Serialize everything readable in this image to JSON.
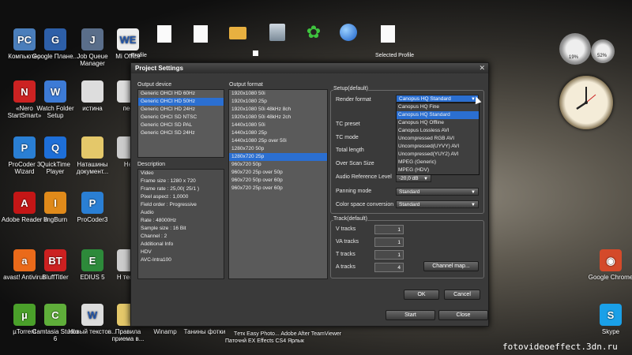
{
  "desktop": {
    "icons": [
      {
        "label": "Компьютер",
        "color": "#4a7ebb",
        "glyph": "PC"
      },
      {
        "label": "Google Плане...",
        "color": "#2d5fa8",
        "glyph": "G"
      },
      {
        "label": "Job Queue Manager",
        "color": "#5a6e8a",
        "glyph": "J"
      },
      {
        "label": "Mi Office",
        "color": "#eeeeee",
        "glyph": "WE"
      },
      {
        "label": "«Nero StartSmart»",
        "color": "#cc2222",
        "glyph": "N"
      },
      {
        "label": "Watch Folder Setup",
        "color": "#3d7bd6",
        "glyph": "W"
      },
      {
        "label": "истина",
        "color": "#dddddd",
        "glyph": ""
      },
      {
        "label": "пес",
        "color": "#dddddd",
        "glyph": ""
      },
      {
        "label": "ProCoder 3 Wizard",
        "color": "#2a7fd4",
        "glyph": "P"
      },
      {
        "label": "QuickTime Player",
        "color": "#1e6fd8",
        "glyph": "Q"
      },
      {
        "label": "Наташины документ...",
        "color": "#e4c86a",
        "glyph": ""
      },
      {
        "label": "Не",
        "color": "#cccccc",
        "glyph": ""
      },
      {
        "label": "Adobe Reader 8",
        "color": "#c41616",
        "glyph": "A"
      },
      {
        "label": "ImgBurn",
        "color": "#e08a1a",
        "glyph": "I"
      },
      {
        "label": "ProCoder3",
        "color": "#2a7fd4",
        "glyph": "P"
      },
      {
        "label": "avast! Antivirus",
        "color": "#ea6a1a",
        "glyph": "a"
      },
      {
        "label": "BluffTitler",
        "color": "#cc2020",
        "glyph": "BT"
      },
      {
        "label": "EDIUS 5",
        "color": "#2d8a3a",
        "glyph": "E"
      },
      {
        "label": "Н тексо",
        "color": "#cccccc",
        "glyph": ""
      },
      {
        "label": "µTorrent",
        "color": "#4aa02a",
        "glyph": "µ"
      },
      {
        "label": "Camtasia Studio 6",
        "color": "#5fae3a",
        "glyph": "C"
      },
      {
        "label": "Новый текстов...",
        "color": "#dddddd",
        "glyph": "W"
      },
      {
        "label": "Правила приема в...",
        "color": "#e4c86a",
        "glyph": ""
      },
      {
        "label": "Winamp",
        "color": "#e88a2a",
        "glyph": ""
      },
      {
        "label": "Танины фотки",
        "color": "#e4c86a",
        "glyph": ""
      },
      {
        "label": "Google Chrome",
        "color": "#d44a2a",
        "glyph": "◉"
      },
      {
        "label": "Skype",
        "color": "#1aa0e8",
        "glyph": "S"
      }
    ],
    "profile_left": "Profile",
    "profile_right": "Selected Profile",
    "taskbar_labels": "Tетк  Easy Photo...  Adobe After  TeamViewer",
    "taskbar_sub": "Паточнй  EX  Effects CS4  Ярлык",
    "watermark": "fotovideoeffect.3dn.ru",
    "gadget_percent1": "19%",
    "gadget_percent2": "52%"
  },
  "dialog": {
    "title": "Project Settings",
    "output_device_label": "Output device",
    "output_devices": [
      "Generic OHCI HD 60Hz",
      "Generic OHCI HD 50Hz",
      "Generic OHCI HD 24Hz",
      "Generic OHCI SD NTSC",
      "Generic OHCI SD PAL",
      "Generic OHCI SD 24Hz"
    ],
    "selected_device": 1,
    "output_format_label": "Output format",
    "output_formats": [
      "1920x1080 50i",
      "1920x1080 25p",
      "1920x1080 50i 48kHz 8ch",
      "1920x1080 50i 48kHz 2ch",
      "1440x1080 50i",
      "1440x1080 25p",
      "1440x1080 25p over 50i",
      "1280x720 50p",
      "1280x720 25p",
      "960x720 50p",
      "960x720 25p over 50p",
      "960x720 50p over 60p",
      "960x720 25p over 60p"
    ],
    "selected_format": 8,
    "description_label": "Description",
    "description_lines": [
      "Video",
      "  Frame size : 1280 x 720",
      "  Frame rate : 25,00( 25/1 )",
      "  Pixel aspect : 1,0000",
      "  Field order : Progressive",
      "Audio",
      "  Rate : 48000Hz",
      "  Sample size : 16 Bit",
      "  Channel : 2",
      "Additional Info",
      "HDV",
      "AVC-Intra100"
    ],
    "setup_label": "Setup(default)",
    "render_format_label": "Render format",
    "render_format_value": "Canopus HQ Standard",
    "render_options": [
      "Canopus HQ Fine",
      "Canopus HQ Standard",
      "Canopus HQ Offline",
      "Canopus Lossless AVI",
      "Uncompressed RGB AVI",
      "Uncompressed(UYVY) AVI",
      "Uncompressed(YUY2) AVI",
      "MPEG (Generic)",
      "MPEG (HDV)"
    ],
    "selected_render_option": 1,
    "tc_preset_label": "TC preset",
    "tc_mode_label": "TC mode",
    "total_length_label": "Total length",
    "over_scan_label": "Over Scan Size",
    "audio_ref_label": "Audio Reference Level",
    "audio_ref_value": "-20,0 dB",
    "panning_label": "Panning mode",
    "panning_value": "Standard",
    "color_space_label": "Color space conversion",
    "color_space_value": "Standard",
    "track_label": "Track(default)",
    "tracks": [
      {
        "label": "V tracks",
        "value": "1"
      },
      {
        "label": "VA tracks",
        "value": "1"
      },
      {
        "label": "T tracks",
        "value": "1"
      },
      {
        "label": "A tracks",
        "value": "4"
      }
    ],
    "channel_map_label": "Channel map...",
    "ok_label": "OK",
    "cancel_label": "Cancel",
    "start_label": "Start",
    "close_label": "Close"
  }
}
